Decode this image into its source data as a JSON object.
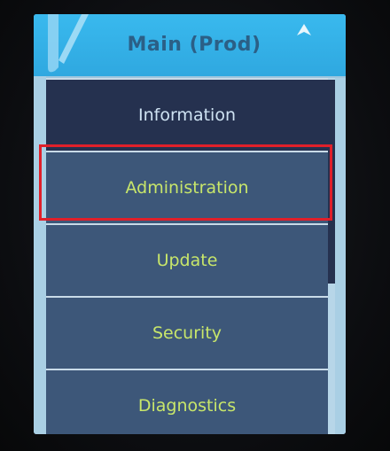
{
  "header": {
    "title": "Main (Prod)",
    "left_icon": "slash-stroke-icon",
    "right_icon": "up-arrow-icon"
  },
  "menu": {
    "items": [
      {
        "label": "Information",
        "selected": true
      },
      {
        "label": "Administration",
        "selected": false
      },
      {
        "label": "Update",
        "selected": false
      },
      {
        "label": "Security",
        "selected": false
      },
      {
        "label": "Diagnostics",
        "selected": false
      }
    ],
    "annotated_item": "Administration"
  },
  "colors": {
    "header_bg": "#39b9ee",
    "header_text": "#2b5f86",
    "item_bg": "#3d5779",
    "item_selected_bg": "#25314f",
    "item_text": "#c8e66a",
    "item_selected_text": "#cfe3f3",
    "annotation_box": "#e0202a"
  }
}
